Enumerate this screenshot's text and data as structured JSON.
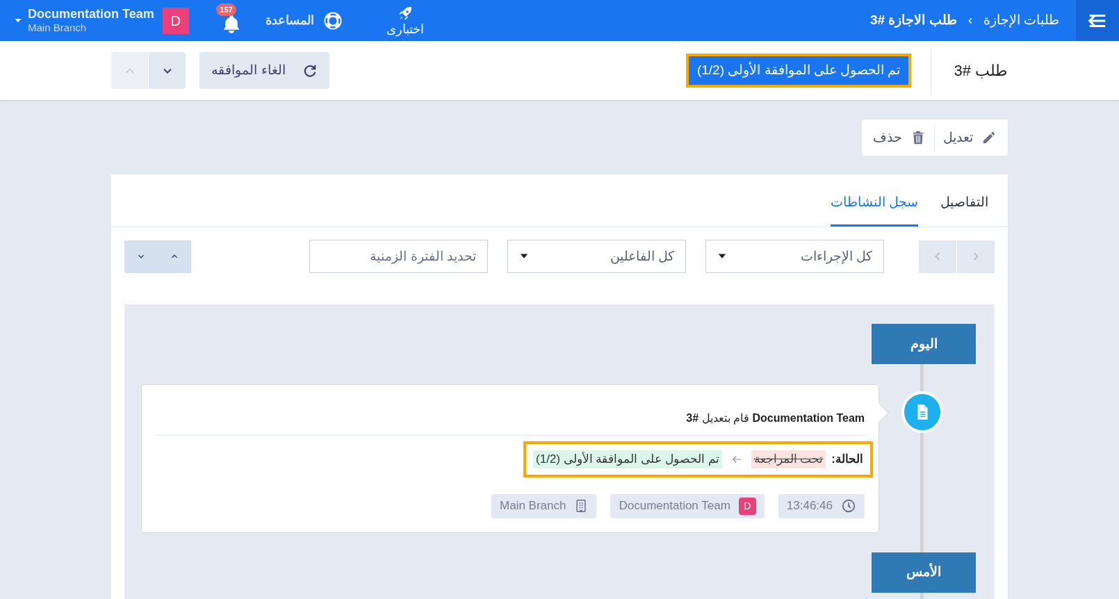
{
  "topbar": {
    "breadcrumb": [
      {
        "label": "طلبات الإجازة",
        "current": false
      },
      {
        "label": "طلب الاجازة #3",
        "current": true
      }
    ],
    "launcher": {
      "label": "اختبارى"
    },
    "help": {
      "label": "المساعدة"
    },
    "notifications": {
      "count": "157"
    },
    "user": {
      "avatar": "D",
      "name": "Documentation Team",
      "branch": "Main Branch"
    }
  },
  "header": {
    "title": "طلب #3",
    "status": {
      "label": "تم الحصول على الموافقة الأولى (1/2)",
      "highlighted": true
    },
    "cancel_button": {
      "label": "الغاء الموافقه"
    },
    "nav": [
      {
        "kind": "up",
        "disabled": true
      },
      {
        "kind": "down",
        "disabled": false
      }
    ]
  },
  "actions": [
    {
      "kind": "edit",
      "label": "تعديل"
    },
    {
      "kind": "delete",
      "label": "حذف"
    }
  ],
  "tabs": [
    {
      "label": "التفاصيل",
      "selected": false
    },
    {
      "label": "سجل النشاطات",
      "selected": true
    }
  ],
  "filters": {
    "dropdowns": [
      {
        "value": "كل الإجراءات"
      },
      {
        "value": "كل الفاعلين"
      }
    ],
    "date_range": {
      "placeholder": "تحديد الفترة الزمنية"
    }
  },
  "timeline": [
    {
      "label": "اليوم",
      "entries": [
        {
          "summary": "**Documentation Team** قام بتعديل **#3**",
          "status_change": {
            "label": "الحالة:",
            "from": "تحت المراجعة",
            "to": "تم الحصول على الموافقة الأولى (1/2)",
            "highlighted": true
          },
          "time": "13:46:46",
          "user_avatar": "D",
          "user": "Documentation Team",
          "branch": "Main Branch"
        }
      ]
    },
    {
      "label": "الأمس"
    }
  ]
}
